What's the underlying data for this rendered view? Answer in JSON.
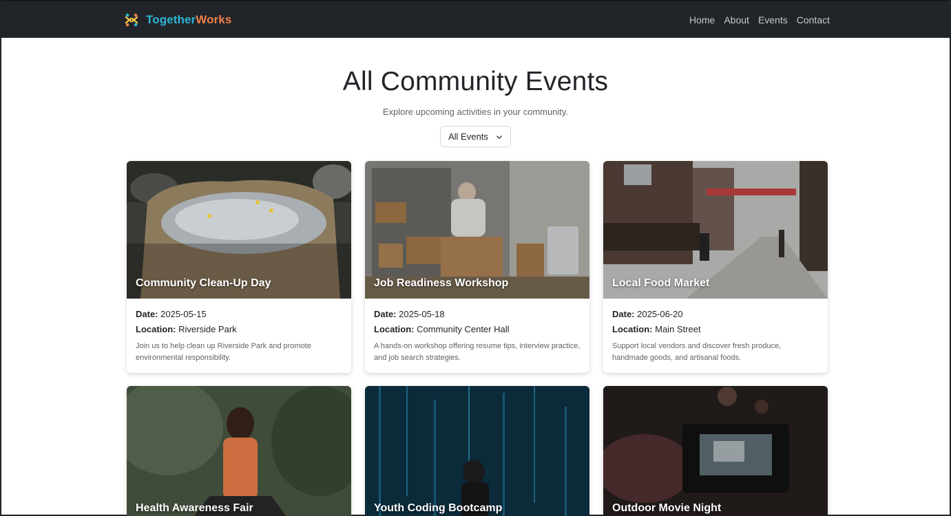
{
  "brand": {
    "part1": "Together",
    "part2": "Works",
    "icon": "people-cross-logo-icon"
  },
  "nav": {
    "links": [
      "Home",
      "About",
      "Events",
      "Contact"
    ]
  },
  "hero": {
    "title": "All Community Events",
    "subtitle": "Explore upcoming activities in your community."
  },
  "filter": {
    "selected": "All Events"
  },
  "labels": {
    "date": "Date:",
    "location": "Location:"
  },
  "events": [
    {
      "title": "Community Clean-Up Day",
      "date": "2025-05-15",
      "location": "Riverside Park",
      "description": "Join us to help clean up Riverside Park and promote environmental responsibility."
    },
    {
      "title": "Job Readiness Workshop",
      "date": "2025-05-18",
      "location": "Community Center Hall",
      "description": "A hands-on workshop offering resume tips, interview practice, and job search strategies."
    },
    {
      "title": "Local Food Market",
      "date": "2025-06-20",
      "location": "Main Street",
      "description": "Support local vendors and discover fresh produce, handmade goods, and artisanal foods."
    },
    {
      "title": "Health Awareness Fair"
    },
    {
      "title": "Youth Coding Bootcamp"
    },
    {
      "title": "Outdoor Movie Night"
    }
  ]
}
